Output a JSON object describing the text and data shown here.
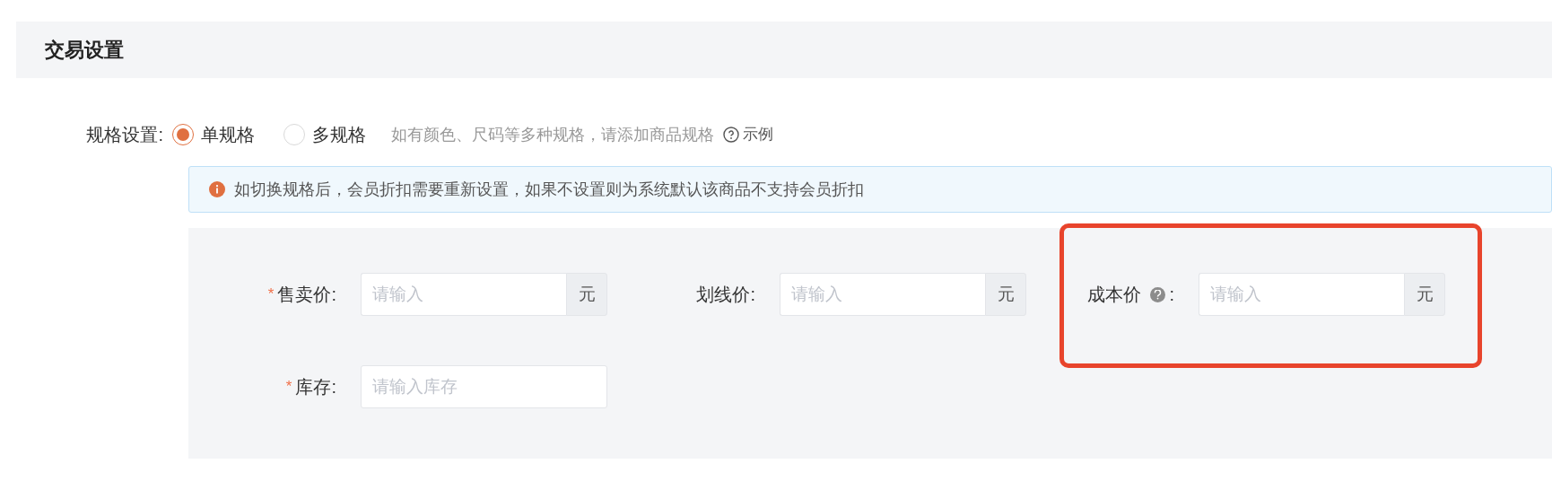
{
  "section": {
    "title": "交易设置"
  },
  "spec": {
    "label": "规格设置:",
    "options": [
      {
        "label": "单规格",
        "selected": true
      },
      {
        "label": "多规格",
        "selected": false
      }
    ],
    "hint": "如有颜色、尺码等多种规格，请添加商品规格",
    "example_link": "示例"
  },
  "notice": "如切换规格后，会员折扣需要重新设置，如果不设置则为系统默认该商品不支持会员折扣",
  "field_rows": [
    [
      {
        "required_mark": "*",
        "label": "售卖价:",
        "placeholder": "请输入",
        "suffix": "元"
      },
      {
        "label": "划线价:",
        "placeholder": "请输入",
        "suffix": "元"
      },
      {
        "label": "成本价",
        "help": true,
        "colon": ":",
        "placeholder": "请输入",
        "suffix": "元",
        "highlighted": true
      }
    ],
    [
      {
        "required_mark": "*",
        "label": "库存:",
        "placeholder": "请输入库存"
      }
    ]
  ]
}
